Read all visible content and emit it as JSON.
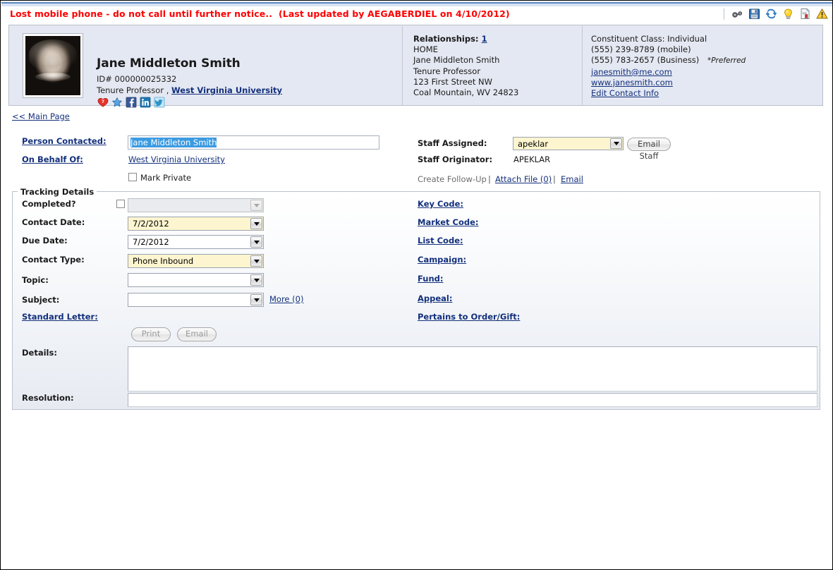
{
  "alert": {
    "message": "Lost mobile phone - do not call until further notice..",
    "updated": "(Last updated by AEGABERDIEL on 4/10/2012)"
  },
  "toolbar": {
    "icons": [
      {
        "name": "binoculars-icon",
        "title": "Search"
      },
      {
        "name": "save-icon",
        "title": "Save"
      },
      {
        "name": "refresh-icon",
        "title": "Refresh"
      },
      {
        "name": "lightbulb-icon",
        "title": "Tips"
      },
      {
        "name": "document-icon",
        "title": "Report"
      },
      {
        "name": "warning-icon",
        "title": "Alert"
      }
    ]
  },
  "constituent": {
    "name": "Jane Middleton Smith",
    "id_label": "ID# 000000025332",
    "title": "Tenure Professor ,",
    "organization": "West Virginia University",
    "social": [
      {
        "name": "heart-badge-icon",
        "badge": "7"
      },
      {
        "name": "star-icon"
      },
      {
        "name": "facebook-icon",
        "glyph": "f"
      },
      {
        "name": "linkedin-icon",
        "glyph": "in"
      },
      {
        "name": "twitter-icon",
        "glyph": "t"
      }
    ],
    "relationships": {
      "label": "Relationships:",
      "count": "1",
      "lines": [
        "HOME",
        "Jane Middleton Smith",
        "Tenure Professor",
        "123 First Street NW",
        "Coal Mountain, WV 24823"
      ]
    },
    "contact": {
      "class": "Constituent Class: Individual",
      "phone_mobile": "(555) 239-8789 (mobile)",
      "phone_business": "(555) 783-2657 (Business)",
      "preferred_note": "*Preferred",
      "email": "janesmith@me.com",
      "website": "www.janesmith.com",
      "edit_link": "Edit Contact Info"
    }
  },
  "nav": {
    "main_page": "<< Main Page"
  },
  "form": {
    "person_contacted_label": "Person Contacted:",
    "person_contacted_value": "Jane Middleton Smith",
    "on_behalf_of_label": "On Behalf Of:",
    "on_behalf_of_value": "West Virginia University",
    "mark_private_label": "Mark Private",
    "staff_assigned_label": "Staff Assigned:",
    "staff_assigned_value": "apeklar",
    "email_staff_button": "Email Staff",
    "staff_originator_label": "Staff Originator:",
    "staff_originator_value": "APEKLAR",
    "create_follow_up": "Create Follow-Up",
    "attach_file": "Attach File (0)",
    "email_link": "Email",
    "pipe": "|"
  },
  "tracking": {
    "legend": "Tracking Details",
    "fields": [
      {
        "label": "Completed?",
        "value": "",
        "style": "disabled"
      },
      {
        "label": "Contact Date:",
        "value": "7/2/2012",
        "style": "yellow"
      },
      {
        "label": "Due Date:",
        "value": "7/2/2012",
        "style": "white"
      },
      {
        "label": "Contact Type:",
        "value": "Phone Inbound",
        "style": "yellow"
      },
      {
        "label": "Topic:",
        "value": "",
        "style": "white"
      },
      {
        "label": "Subject:",
        "value": "",
        "style": "white"
      }
    ],
    "more_link": "More (0)",
    "standard_letter": "Standard Letter:",
    "print_button": "Print",
    "email_button": "Email",
    "details_label": "Details:",
    "details_value": "",
    "resolution_label": "Resolution:",
    "resolution_value": "",
    "code_links": [
      "Key Code:",
      "Market Code:",
      "List Code:",
      "Campaign:",
      "Fund:",
      "Appeal:",
      "Pertains to Order/Gift:"
    ]
  },
  "colors": {
    "alert_red": "#ff0000",
    "link_blue": "#13307c",
    "header_bg": "#e4e8f2",
    "required_yellow": "#fdf5cf",
    "selection_blue": "#3b9ae1"
  }
}
